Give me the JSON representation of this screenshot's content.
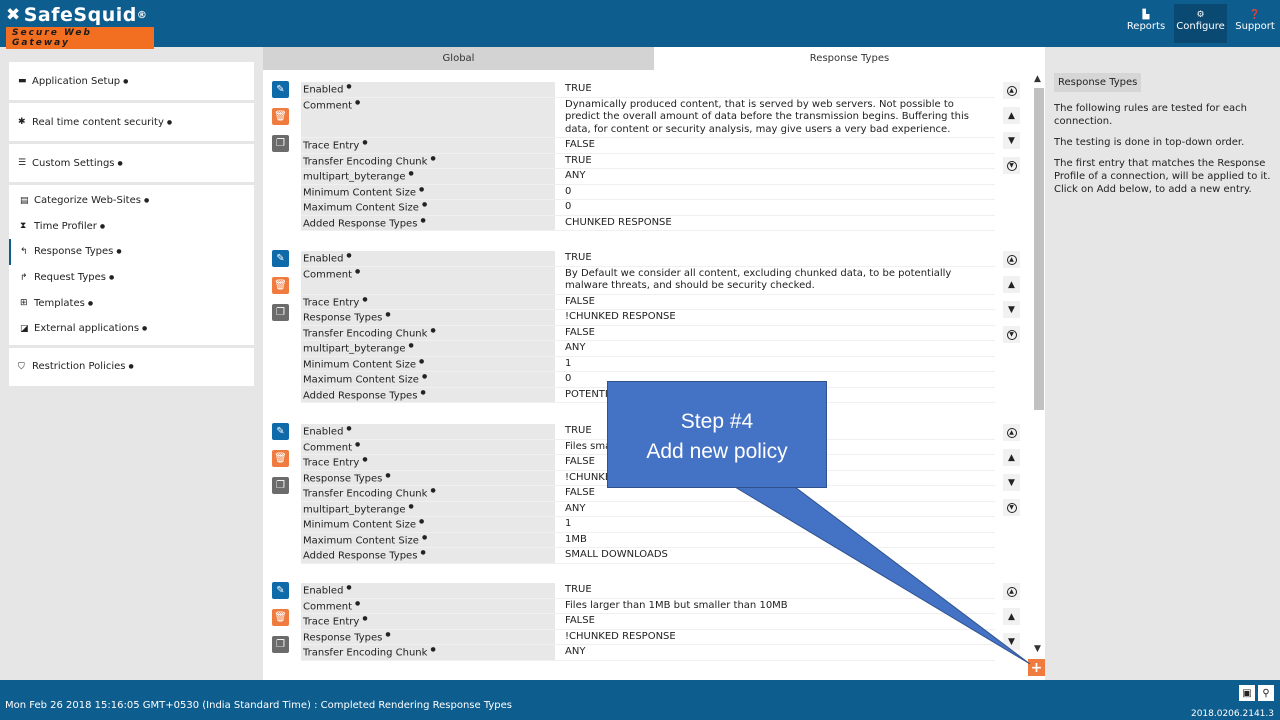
{
  "brand": {
    "name": "SafeSquid",
    "reg": "®",
    "tagline": "Secure Web Gateway"
  },
  "topnav": [
    {
      "label": "Reports",
      "icon": "chart-icon"
    },
    {
      "label": "Configure",
      "icon": "gears-icon"
    },
    {
      "label": "Support",
      "icon": "question-icon"
    }
  ],
  "sidebar": {
    "groups": [
      {
        "label": "Application Setup",
        "icon": "briefcase-icon"
      },
      {
        "label": "Real time content security",
        "icon": "bug-icon"
      },
      {
        "label": "Custom Settings",
        "icon": "sliders-icon"
      }
    ],
    "sub_items": [
      {
        "label": "Categorize Web-Sites",
        "icon": "database-icon"
      },
      {
        "label": "Time Profiler",
        "icon": "hourglass-icon"
      },
      {
        "label": "Response Types",
        "icon": "reply-icon"
      },
      {
        "label": "Request Types",
        "icon": "share-icon"
      },
      {
        "label": "Templates",
        "icon": "sitemap-icon"
      },
      {
        "label": "External applications",
        "icon": "external-icon"
      }
    ],
    "last": {
      "label": "Restriction Policies",
      "icon": "shield-icon"
    }
  },
  "tabs": {
    "global": "Global",
    "response_types": "Response Types"
  },
  "policies": [
    {
      "rows": [
        {
          "k": "Enabled",
          "v": "TRUE"
        },
        {
          "k": "Comment",
          "v": "Dynamically produced content, that is served by web servers. Not possible to predict the overall amount of data before the transmission begins. Buffering this data, for content or security analysis, may give users a very bad experience."
        },
        {
          "k": "Trace Entry",
          "v": "FALSE"
        },
        {
          "k": "Transfer Encoding Chunk",
          "v": "TRUE"
        },
        {
          "k": "multipart_byterange",
          "v": "ANY"
        },
        {
          "k": "Minimum Content Size",
          "v": "0"
        },
        {
          "k": "Maximum Content Size",
          "v": "0"
        },
        {
          "k": "Added Response Types",
          "v": "CHUNKED RESPONSE"
        }
      ]
    },
    {
      "rows": [
        {
          "k": "Enabled",
          "v": "TRUE"
        },
        {
          "k": "Comment",
          "v": "By Default we consider all content, excluding chunked data, to be potentially malware threats, and should be security checked."
        },
        {
          "k": "Trace Entry",
          "v": "FALSE"
        },
        {
          "k": "Response Types",
          "v": "!CHUNKED RESPONSE"
        },
        {
          "k": "Transfer Encoding Chunk",
          "v": "FALSE"
        },
        {
          "k": "multipart_byterange",
          "v": "ANY"
        },
        {
          "k": "Minimum Content Size",
          "v": "1"
        },
        {
          "k": "Maximum Content Size",
          "v": "0"
        },
        {
          "k": "Added Response Types",
          "v": "POTENTIA"
        }
      ]
    },
    {
      "rows": [
        {
          "k": "Enabled",
          "v": "TRUE"
        },
        {
          "k": "Comment",
          "v": "Files smal"
        },
        {
          "k": "Trace Entry",
          "v": "FALSE"
        },
        {
          "k": "Response Types",
          "v": "!CHUNKED"
        },
        {
          "k": "Transfer Encoding Chunk",
          "v": "FALSE"
        },
        {
          "k": "multipart_byterange",
          "v": "ANY"
        },
        {
          "k": "Minimum Content Size",
          "v": "1"
        },
        {
          "k": "Maximum Content Size",
          "v": "1MB"
        },
        {
          "k": "Added Response Types",
          "v": "SMALL DOWNLOADS"
        }
      ]
    },
    {
      "rows": [
        {
          "k": "Enabled",
          "v": "TRUE"
        },
        {
          "k": "Comment",
          "v": "Files larger than 1MB but smaller than 10MB"
        },
        {
          "k": "Trace Entry",
          "v": "FALSE"
        },
        {
          "k": "Response Types",
          "v": "!CHUNKED RESPONSE"
        },
        {
          "k": "Transfer Encoding Chunk",
          "v": "ANY"
        }
      ]
    }
  ],
  "help": {
    "title": "Response Types",
    "paragraphs": [
      "The following rules are tested for each connection.",
      "The testing is done in top-down order.",
      "The first entry that matches the Response Profile of a connection, will be applied to it. Click on Add below, to add a new entry."
    ]
  },
  "callout": {
    "line1": "Step #4",
    "line2": "Add new policy",
    "color": "#4472c4"
  },
  "footer": {
    "status": "Mon Feb 26 2018 15:16:05 GMT+0530 (India Standard Time) : Completed Rendering Response Types",
    "version": "2018.0206.2141.3"
  },
  "colors": {
    "header": "#0e5d8f",
    "accent": "#f07b3f",
    "edit": "#0e6aa8"
  }
}
